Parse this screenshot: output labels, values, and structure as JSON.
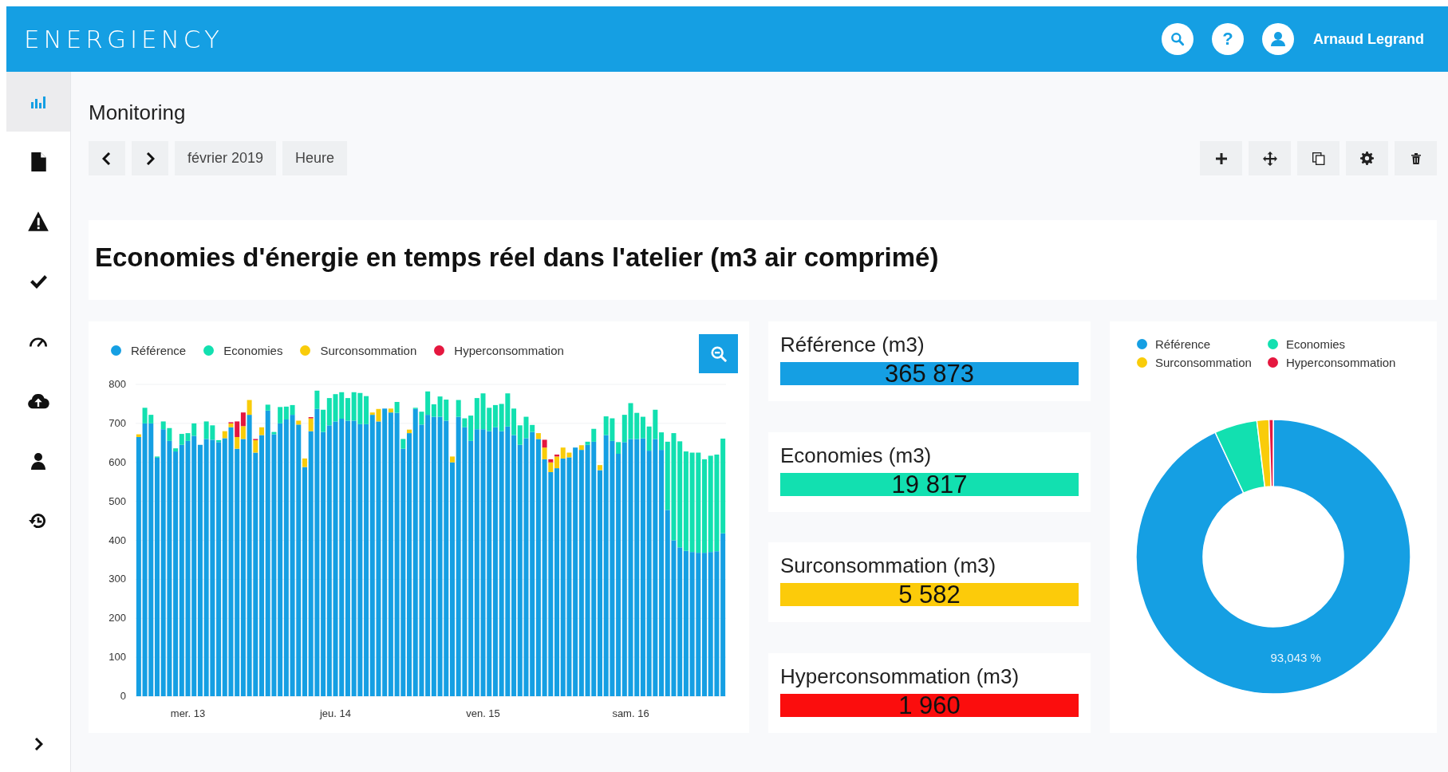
{
  "header": {
    "logo": "ENERGIENCY",
    "help": "?",
    "user_name": "Arnaud Legrand"
  },
  "sidebar": {
    "items": [
      {
        "selected": true
      },
      {
        "selected": false
      },
      {
        "selected": false
      },
      {
        "selected": false
      },
      {
        "selected": false
      },
      {
        "selected": false
      },
      {
        "selected": false
      },
      {
        "selected": false
      }
    ]
  },
  "page_title": "Monitoring",
  "toolbar": {
    "period": "février 2019",
    "granularity": "Heure"
  },
  "dashboard_title": "Economies d'énergie en temps réel dans l'atelier (m3 air comprimé)",
  "bar_chart": {
    "chart_data": {
      "type": "bar",
      "stacked": true,
      "grid": true,
      "categories": [
        null,
        null,
        null,
        null,
        null,
        null,
        null,
        null,
        "mer. 13",
        null,
        null,
        null,
        null,
        null,
        null,
        null,
        null,
        null,
        null,
        null,
        null,
        null,
        null,
        null,
        null,
        null,
        null,
        null,
        null,
        null,
        null,
        null,
        "jeu. 14",
        null,
        null,
        null,
        null,
        null,
        null,
        null,
        null,
        null,
        null,
        null,
        null,
        null,
        null,
        null,
        null,
        null,
        null,
        null,
        null,
        null,
        null,
        null,
        "ven. 15",
        null,
        null,
        null,
        null,
        null,
        null,
        null,
        null,
        null,
        null,
        null,
        null,
        null,
        null,
        null,
        null,
        null,
        null,
        null,
        null,
        null,
        null,
        null,
        "sam. 16",
        null,
        null,
        null,
        null,
        null,
        null,
        null,
        null,
        null,
        null,
        null,
        null,
        null,
        null,
        null
      ],
      "yticks": [
        0,
        100,
        200,
        300,
        400,
        500,
        600,
        700,
        800
      ],
      "ylim": [
        0,
        800
      ],
      "series": [
        {
          "name": "Référence",
          "color": "#159fe3",
          "values": [
            665,
            700,
            700,
            612,
            685,
            655,
            628,
            645,
            655,
            668,
            645,
            660,
            658,
            652,
            662,
            690,
            635,
            660,
            722,
            625,
            670,
            733,
            672,
            700,
            710,
            722,
            697,
            588,
            680,
            737,
            678,
            695,
            705,
            712,
            707,
            707,
            698,
            698,
            722,
            705,
            738,
            728,
            727,
            635,
            675,
            737,
            697,
            722,
            717,
            717,
            707,
            600,
            717,
            690,
            655,
            685,
            685,
            680,
            690,
            680,
            692,
            670,
            645,
            662,
            678,
            660,
            608,
            575,
            585,
            610,
            613,
            638,
            632,
            645,
            653,
            580,
            670,
            655,
            622,
            652,
            660,
            660,
            662,
            630,
            660,
            632,
            478,
            400,
            382,
            373,
            370,
            368,
            368,
            370,
            372,
            418
          ]
        },
        {
          "name": "Economies",
          "color": "#12e0b0",
          "values": [
            0,
            40,
            22,
            3,
            20,
            33,
            8,
            28,
            20,
            32,
            0,
            45,
            37,
            5,
            0,
            0,
            0,
            0,
            0,
            0,
            0,
            15,
            6,
            42,
            33,
            25,
            0,
            0,
            0,
            47,
            57,
            70,
            70,
            68,
            58,
            73,
            80,
            72,
            0,
            0,
            0,
            0,
            28,
            25,
            0,
            3,
            33,
            60,
            32,
            52,
            54,
            0,
            43,
            23,
            65,
            80,
            92,
            60,
            57,
            70,
            85,
            68,
            50,
            55,
            18,
            0,
            0,
            0,
            0,
            0,
            0,
            0,
            0,
            8,
            33,
            0,
            48,
            58,
            30,
            70,
            92,
            67,
            55,
            62,
            75,
            45,
            175,
            275,
            272,
            255,
            255,
            257,
            240,
            247,
            248,
            243
          ]
        },
        {
          "name": "Surconsommation",
          "color": "#f9cc0a",
          "values": [
            7,
            0,
            0,
            0,
            0,
            0,
            0,
            0,
            0,
            0,
            0,
            0,
            0,
            0,
            18,
            10,
            30,
            33,
            38,
            32,
            20,
            0,
            0,
            0,
            0,
            0,
            10,
            22,
            33,
            0,
            0,
            0,
            0,
            0,
            0,
            0,
            0,
            0,
            6,
            32,
            0,
            10,
            0,
            0,
            9,
            0,
            0,
            0,
            0,
            0,
            0,
            15,
            0,
            0,
            0,
            0,
            0,
            0,
            0,
            0,
            0,
            0,
            0,
            0,
            0,
            15,
            30,
            25,
            30,
            28,
            12,
            0,
            12,
            0,
            0,
            13,
            0,
            0,
            0,
            0,
            0,
            0,
            0,
            0,
            0,
            0,
            0,
            0,
            0,
            0,
            0,
            0,
            0,
            0,
            0,
            0
          ]
        },
        {
          "name": "Hyperconsommation",
          "color": "#e5173f",
          "values": [
            0,
            0,
            0,
            0,
            0,
            0,
            0,
            0,
            0,
            0,
            0,
            0,
            0,
            0,
            0,
            3,
            40,
            35,
            0,
            3,
            0,
            0,
            0,
            0,
            0,
            0,
            0,
            0,
            3,
            0,
            0,
            0,
            0,
            0,
            0,
            0,
            0,
            0,
            0,
            0,
            0,
            0,
            0,
            0,
            0,
            0,
            0,
            0,
            0,
            0,
            0,
            0,
            0,
            0,
            0,
            0,
            0,
            0,
            0,
            0,
            0,
            0,
            0,
            0,
            0,
            0,
            20,
            8,
            5,
            0,
            0,
            0,
            0,
            0,
            0,
            0,
            0,
            0,
            0,
            0,
            0,
            0,
            0,
            0,
            0,
            0,
            0,
            0,
            0,
            0,
            0,
            0,
            0,
            0,
            0,
            0
          ]
        }
      ]
    }
  },
  "kpis": [
    {
      "title": "Référence (m3)",
      "value": "365 873",
      "color": "#159fe3"
    },
    {
      "title": "Economies (m3)",
      "value": "19 817",
      "color": "#12e0b0"
    },
    {
      "title": "Surconsommation (m3)",
      "value": "5 582",
      "color": "#fccb0a"
    },
    {
      "title": "Hyperconsommation (m3)",
      "value": "1 960",
      "color": "#fb0d0d"
    }
  ],
  "donut_chart": {
    "chart_data": {
      "type": "donut",
      "categories": [
        "Référence",
        "Economies",
        "Surconsommation",
        "Hyperconsommation"
      ],
      "values": [
        93.043,
        5.04,
        1.419,
        0.498
      ],
      "colors": [
        "#159fe3",
        "#12e0b0",
        "#f9cc0a",
        "#e5173f"
      ],
      "annotations": [
        {
          "text": "93,043 %"
        }
      ]
    }
  }
}
